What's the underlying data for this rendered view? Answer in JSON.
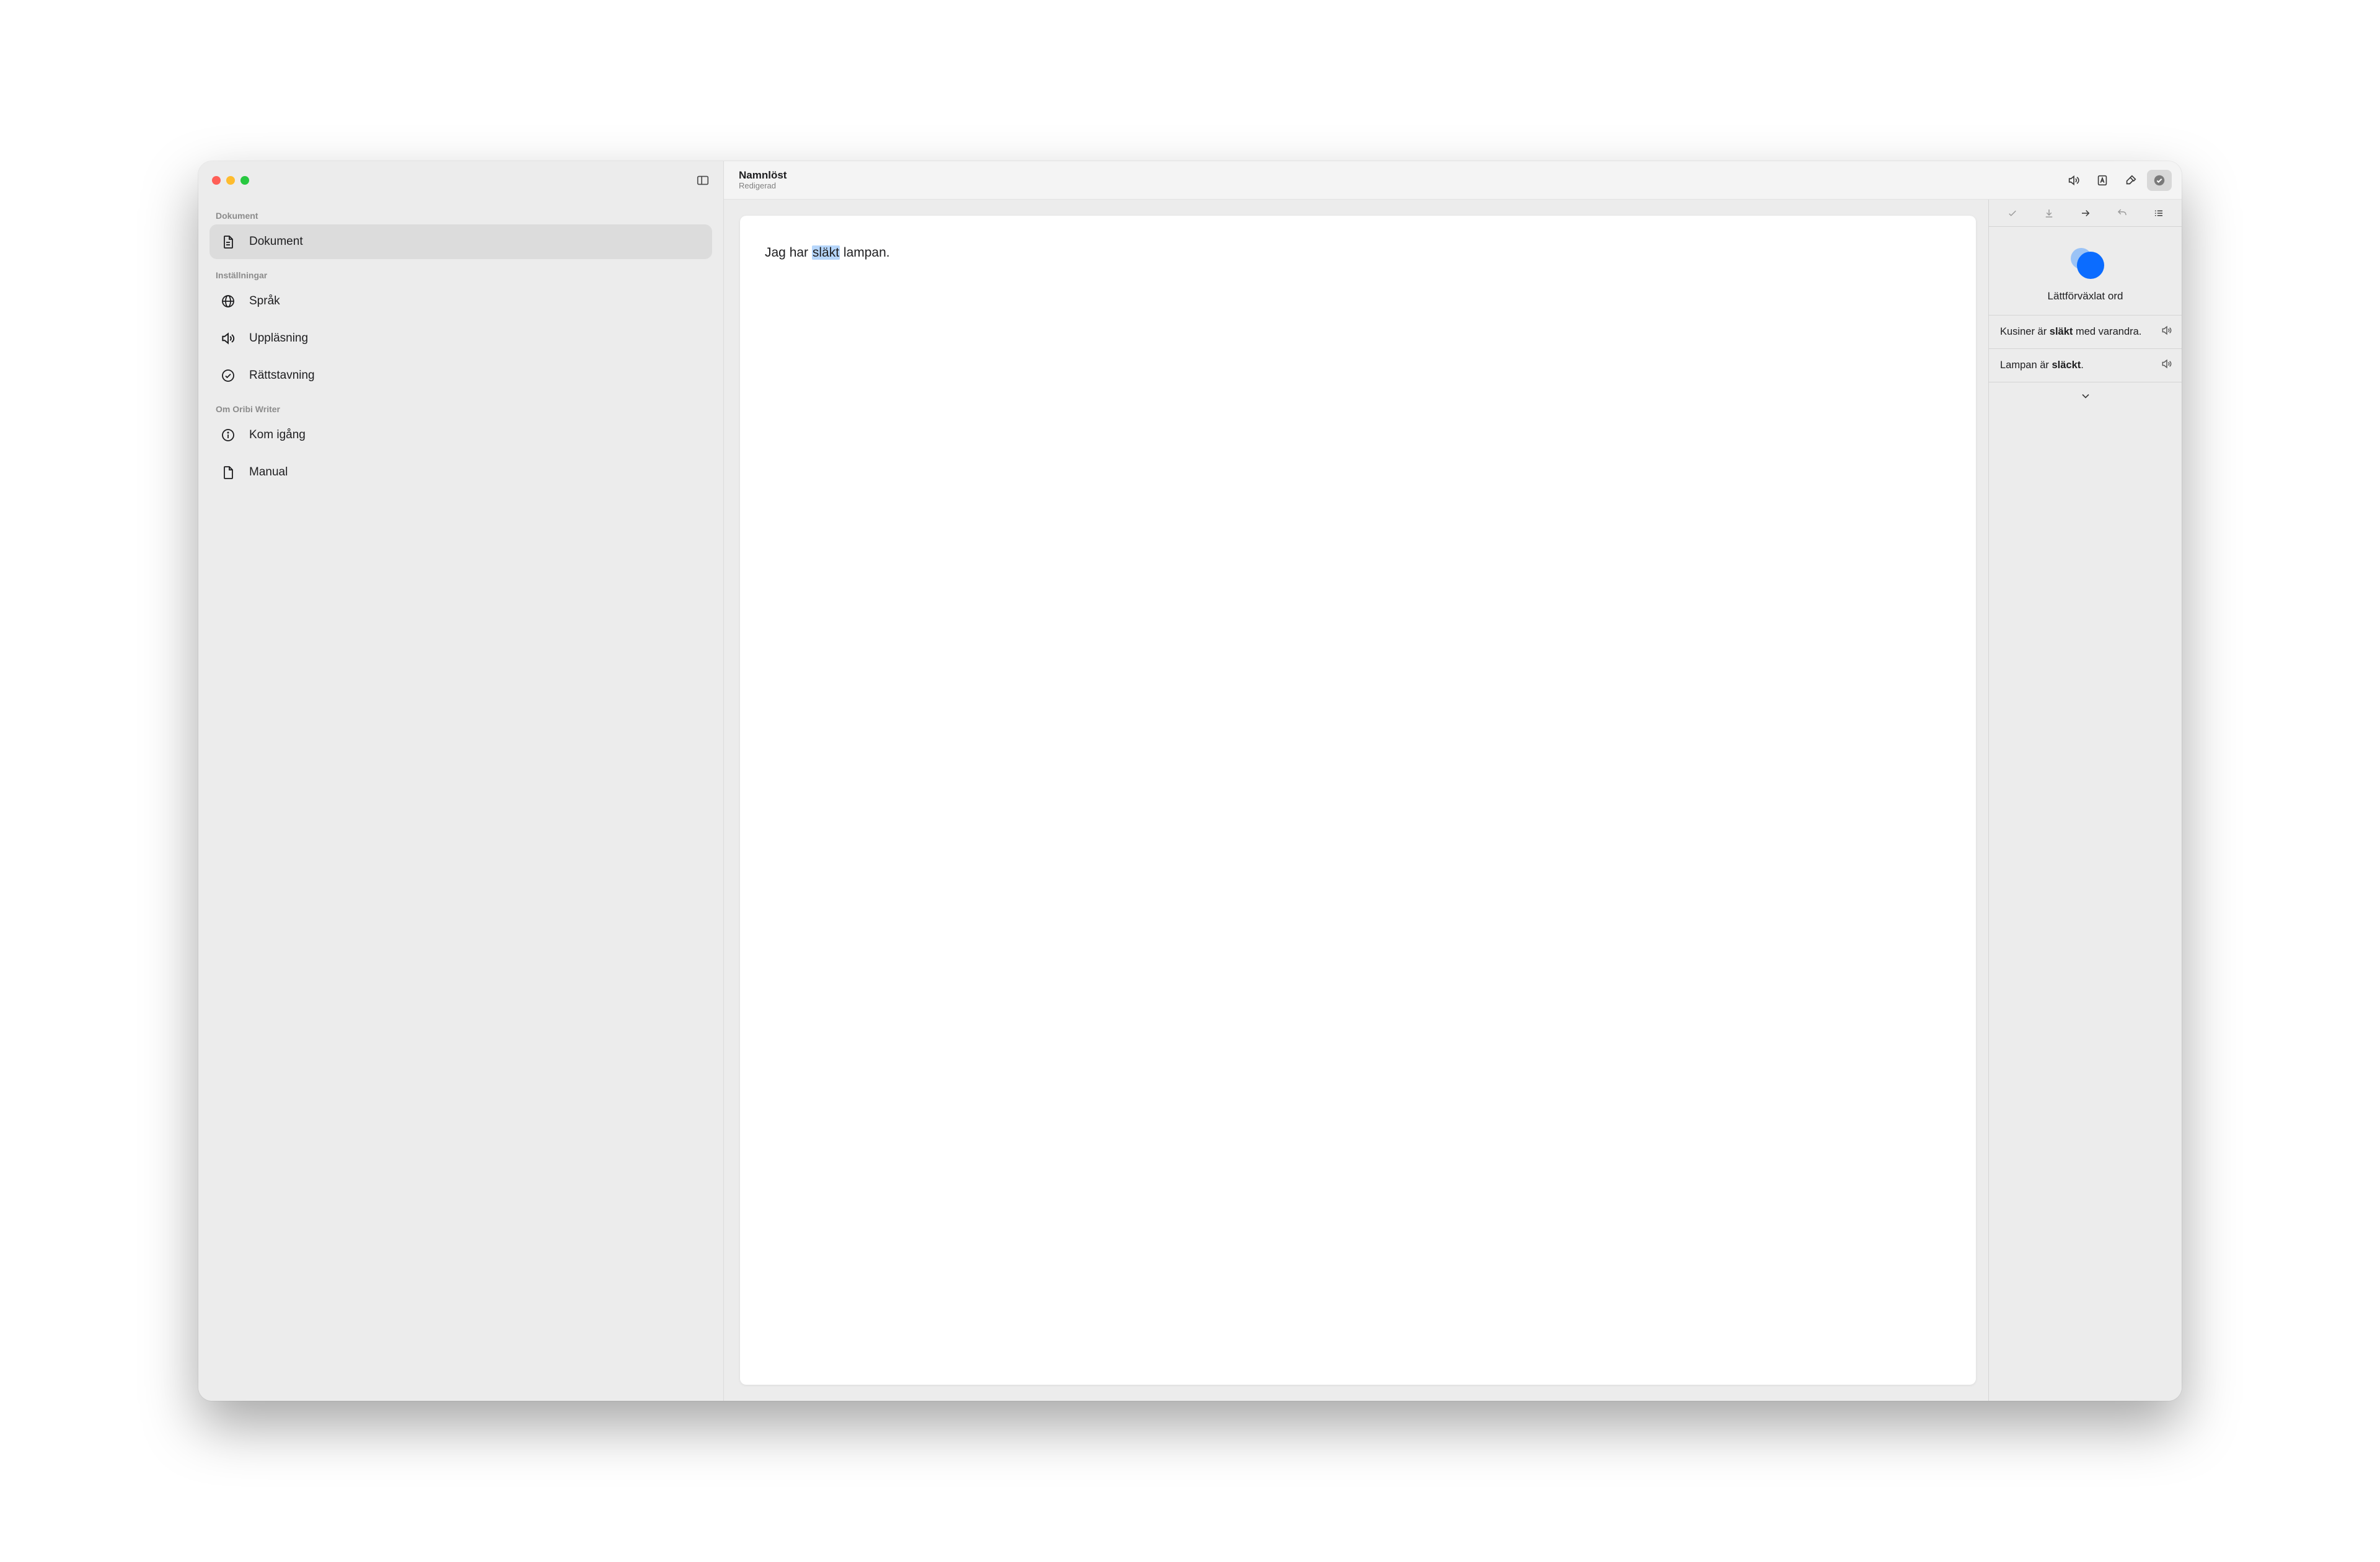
{
  "sidebar": {
    "sections": [
      {
        "label": "Dokument",
        "items": [
          {
            "label": "Dokument",
            "icon": "document-icon",
            "active": true
          }
        ]
      },
      {
        "label": "Inställningar",
        "items": [
          {
            "label": "Språk",
            "icon": "globe-icon"
          },
          {
            "label": "Uppläsning",
            "icon": "speaker-icon"
          },
          {
            "label": "Rättstavning",
            "icon": "check-circle-icon"
          }
        ]
      },
      {
        "label": "Om Oribi Writer",
        "items": [
          {
            "label": "Kom igång",
            "icon": "info-icon"
          },
          {
            "label": "Manual",
            "icon": "document-icon"
          }
        ]
      }
    ]
  },
  "header": {
    "title": "Namnlöst",
    "subtitle": "Redigerad"
  },
  "editor": {
    "before": "Jag har ",
    "highlight": "släkt",
    "after": " lampan."
  },
  "inspector": {
    "caption": "Lättförväxlat ord",
    "examples": [
      {
        "pre": "Kusiner är ",
        "bold": "släkt",
        "post": " med varandra."
      },
      {
        "pre": "Lampan är ",
        "bold": "släckt",
        "post": "."
      }
    ]
  }
}
